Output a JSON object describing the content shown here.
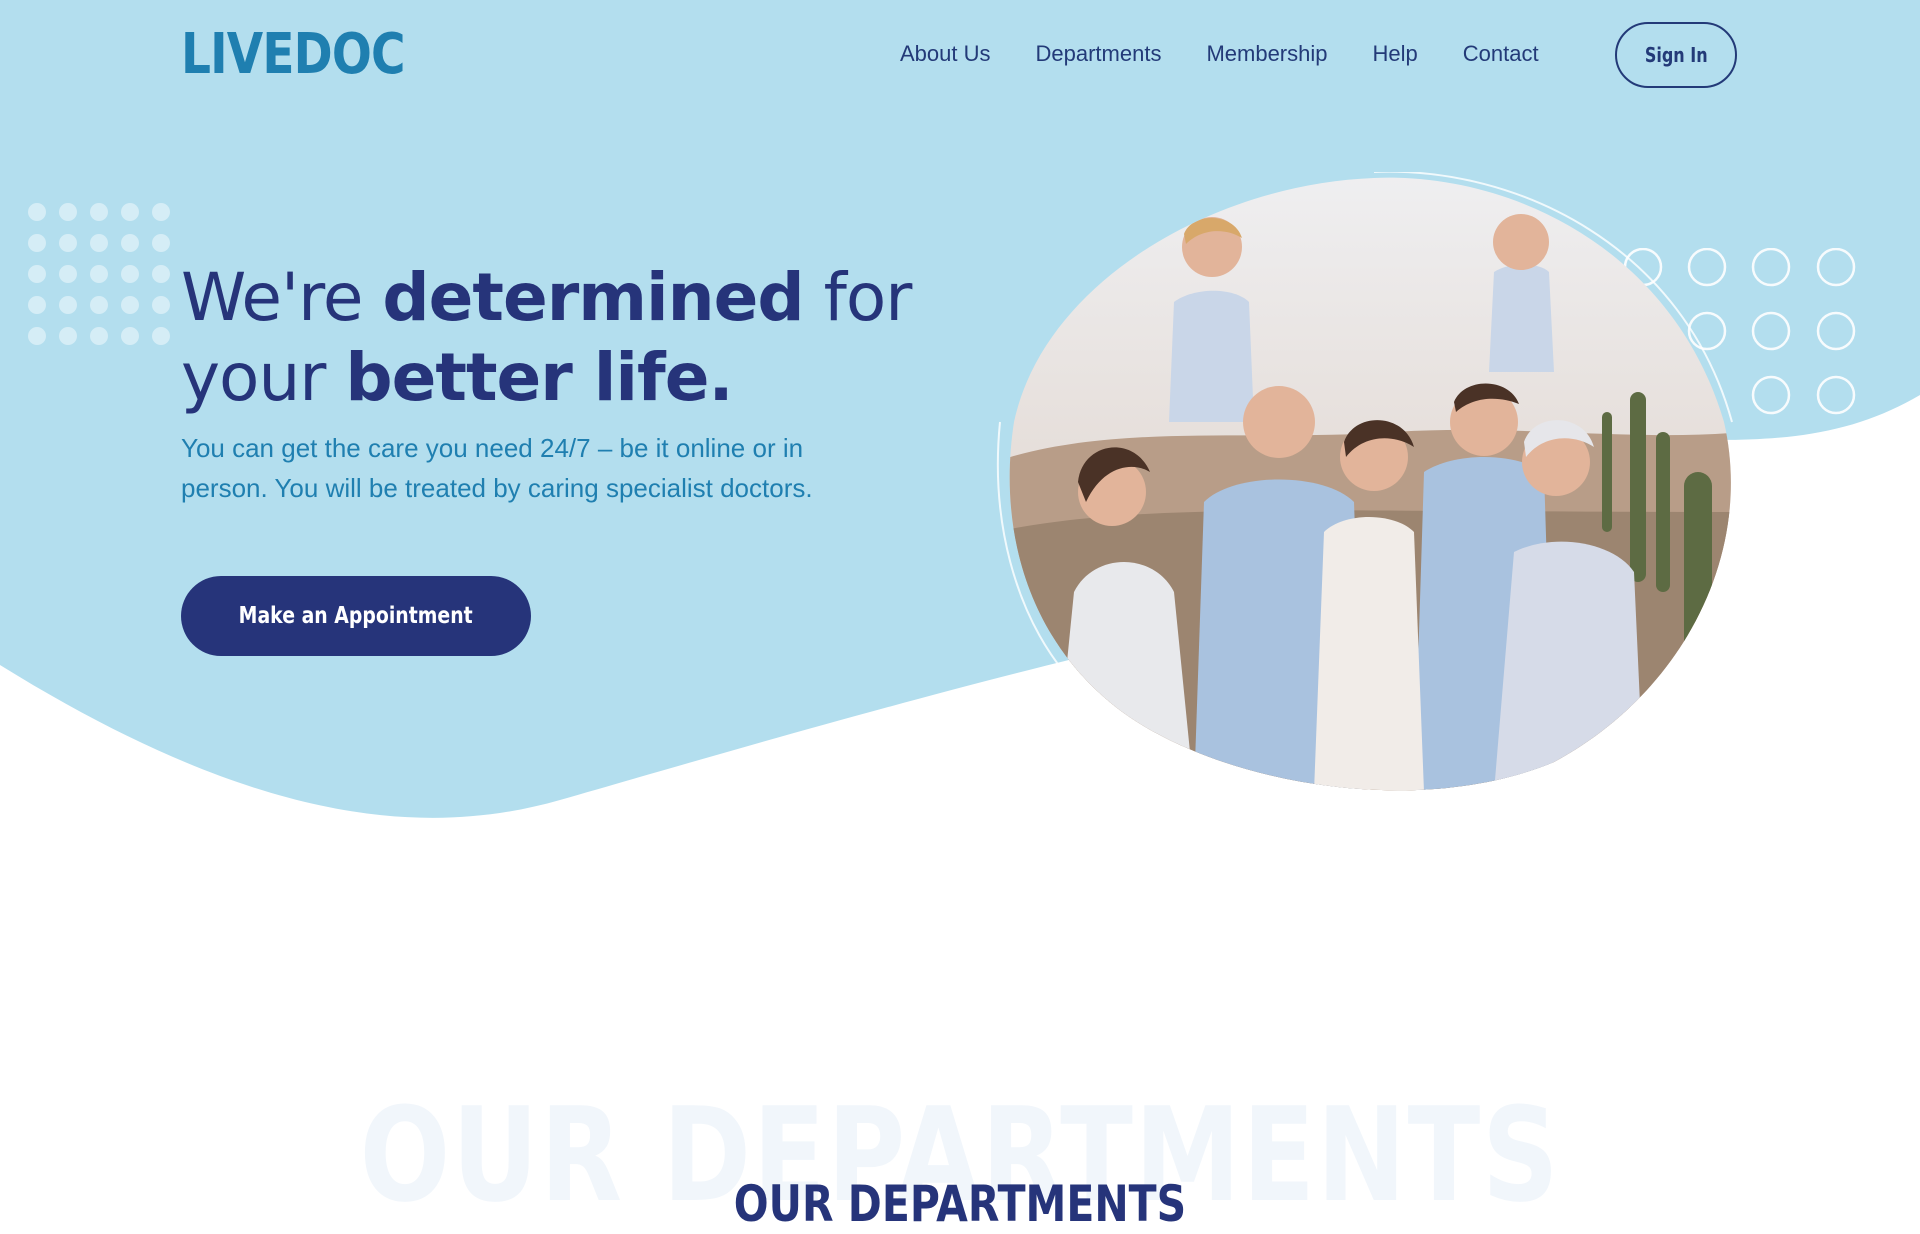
{
  "brand": {
    "logo_text": "LIVEDOC"
  },
  "nav": {
    "items": [
      {
        "label": "About Us"
      },
      {
        "label": "Departments"
      },
      {
        "label": "Membership"
      },
      {
        "label": "Help"
      },
      {
        "label": "Contact"
      }
    ],
    "signin_label": "Sign In"
  },
  "hero": {
    "headline_part1": "We're ",
    "headline_bold1": "determined",
    "headline_part2": " for",
    "headline_part3": "your ",
    "headline_bold2": "better life.",
    "subtext": "You can get the care you need 24/7 – be it online or in person. You will be treated by caring specialist doctors.",
    "cta_label": "Make an Appointment"
  },
  "departments": {
    "ghost_title": "OUR DEPARTMENTS",
    "title": "OUR DEPARTMENTS"
  },
  "colors": {
    "hero_bg": "#b3deee",
    "primary": "#26347a",
    "accent": "#1f7fb0"
  }
}
